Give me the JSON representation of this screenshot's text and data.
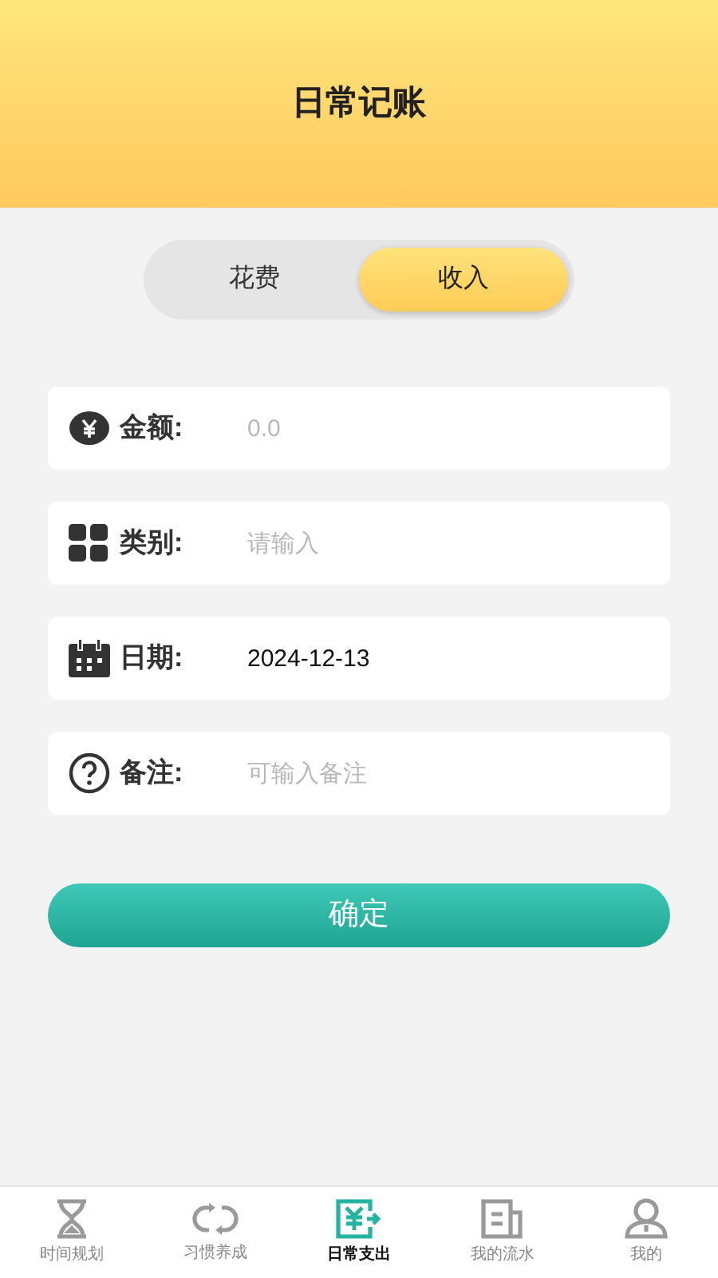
{
  "header": {
    "title": "日常记账"
  },
  "toggle": [
    {
      "label": "花费",
      "selected": false
    },
    {
      "label": "收入",
      "selected": true
    }
  ],
  "fields": [
    {
      "kind": "amount",
      "label": "金额:",
      "placeholder": "0.0"
    },
    {
      "kind": "category",
      "label": "类别:",
      "placeholder": "请输入"
    },
    {
      "kind": "date",
      "label": "日期:",
      "value": "2024-12-13"
    },
    {
      "kind": "note",
      "label": "备注:",
      "placeholder": "可输入备注"
    }
  ],
  "submit": "确定",
  "nav": [
    {
      "kind": "hourglass",
      "label": "时间规划",
      "selected": false
    },
    {
      "kind": "cycle",
      "label": "习惯养成",
      "selected": false
    },
    {
      "kind": "expense",
      "label": "日常支出",
      "selected": true
    },
    {
      "kind": "ledger",
      "label": "我的流水",
      "selected": false
    },
    {
      "kind": "user",
      "label": "我的",
      "selected": false
    }
  ]
}
